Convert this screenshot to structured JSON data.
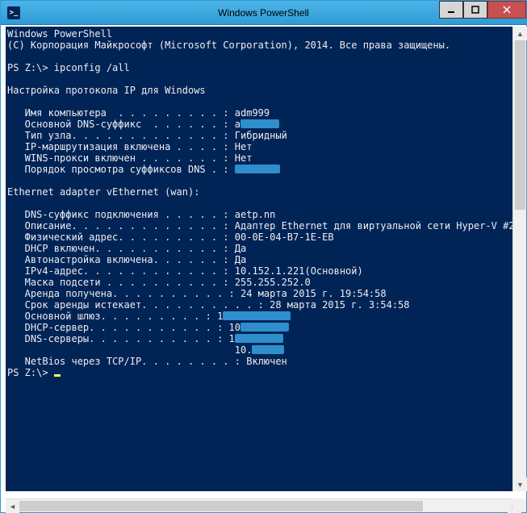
{
  "window": {
    "title": "Windows PowerShell"
  },
  "console": {
    "header1": "Windows PowerShell",
    "header2": "(C) Корпорация Майкрософт (Microsoft Corporation), 2014. Все права защищены.",
    "prompt1": "PS Z:\\> ",
    "command1": "ipconfig /all",
    "section1": "Настройка протокола IP для Windows",
    "host_fields": [
      {
        "label": "   Имя компьютера  . . . . . . . . . :",
        "value": " adm999"
      },
      {
        "label": "   Основной DNS-суффикс  . . . . . . :",
        "value": " a"
      },
      {
        "label": "   Тип узла. . . . . . . . . . . . . :",
        "value": " Гибридный"
      },
      {
        "label": "   IP-маршрутизация включена . . . . :",
        "value": " Нет"
      },
      {
        "label": "   WINS-прокси включен . . . . . . . :",
        "value": " Нет"
      },
      {
        "label": "   Порядок просмотра суффиксов DNS . :",
        "value": " "
      }
    ],
    "adapter_header": "Ethernet adapter vEthernet (wan):",
    "adapter_fields": [
      {
        "label": "   DNS-суффикс подключения . . . . . :",
        "value": " aetp.nn"
      },
      {
        "label": "   Описание. . . . . . . . . . . . . :",
        "value": " Адаптер Ethernet для виртуальной сети Hyper-V #2"
      },
      {
        "label": "   Физический адрес. . . . . . . . . :",
        "value": " 00-0E-04-B7-1E-EB"
      },
      {
        "label": "   DHCP включен. . . . . . . . . . . :",
        "value": " Да"
      },
      {
        "label": "   Автонастройка включена. . . . . . :",
        "value": " Да"
      },
      {
        "label": "   IPv4-адрес. . . . . . . . . . . . :",
        "value": " 10.152.1.221(Основной)"
      },
      {
        "label": "   Маска подсети . . . . . . . . . . :",
        "value": " 255.255.252.0"
      },
      {
        "label": "   Аренда получена. . . . . . . . . . :",
        "value": " 24 марта 2015 г. 19:54:58"
      },
      {
        "label": "   Срок аренды истекает. . . . . . . . . . :",
        "value": " 28 марта 2015 г. 3:54:58"
      },
      {
        "label": "   Основной шлюз. . . . . . . . . :",
        "value": " 1"
      },
      {
        "label": "   DHCP-сервер. . . . . . . . . . . :",
        "value": " 10"
      },
      {
        "label": "   DNS-серверы. . . . . . . . . . . :",
        "value": " 1"
      },
      {
        "label": "                                      ",
        "value": " 10."
      },
      {
        "label": "   NetBios через TCP/IP. . . . . . . . :",
        "value": " Включен"
      }
    ],
    "prompt2": "PS Z:\\> "
  }
}
